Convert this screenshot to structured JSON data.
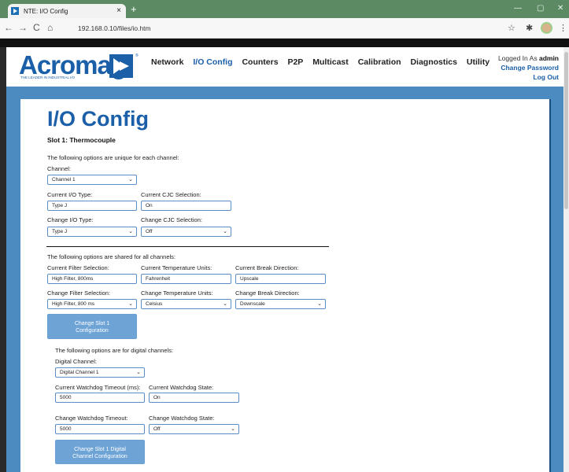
{
  "browser": {
    "tab_title": "NTE: I/O Config",
    "tab_close": "×",
    "new_tab": "+",
    "url": "192.168.0.10/files/io.htm",
    "back": "←",
    "forward": "→",
    "reload": "C",
    "home": "⌂",
    "minimize": "—",
    "maximize": "▢",
    "close": "✕",
    "star": "☆",
    "puzzle": "✱",
    "menu": "⋮"
  },
  "header": {
    "logo_text": "Acromag",
    "logo_reg": "®",
    "logo_tagline": "THE LEADER IN INDUSTRIAL I/O",
    "menu": [
      {
        "label": "Network"
      },
      {
        "label": "I/O Config"
      },
      {
        "label": "Counters"
      },
      {
        "label": "P2P"
      },
      {
        "label": "Multicast"
      },
      {
        "label": "Calibration"
      },
      {
        "label": "Diagnostics"
      },
      {
        "label": "Utility"
      }
    ],
    "logged_in_prefix": "Logged In As",
    "logged_in_user": "admin",
    "change_password": "Change Password",
    "log_out": "Log Out"
  },
  "page": {
    "title": "I/O Config",
    "subtitle": "Slot 1: Thermocouple",
    "unique_intro": "The following options are unique for each channel:",
    "channel_label": "Channel:",
    "channel_value": "Channel 1",
    "current_io_type_label": "Current I/O Type:",
    "current_io_type_value": "Type J",
    "current_cjc_label": "Current CJC Selection:",
    "current_cjc_value": "On",
    "change_io_type_label": "Change I/O Type:",
    "change_io_type_value": "Type J",
    "change_cjc_label": "Change CJC Selection:",
    "change_cjc_value": "Off",
    "shared_intro": "The following options are shared for all channels:",
    "current_filter_label": "Current Filter Selection:",
    "current_filter_value": "High Filter, 800ms",
    "current_temp_label": "Current Temperature Units:",
    "current_temp_value": "Fahrenheit",
    "current_break_label": "Current Break Direction:",
    "current_break_value": "Upscale",
    "change_filter_label": "Change Filter Selection:",
    "change_filter_value": "High Filter, 800 ms",
    "change_temp_label": "Change Temperature Units:",
    "change_temp_value": "Celsius",
    "change_break_label": "Change Break Direction:",
    "change_break_value": "Downscale",
    "change_slot_button_line1": "Change Slot 1",
    "change_slot_button_line2": "Configuration",
    "digital_intro": "The following options are for digital channels:",
    "digital_channel_label": "Digital Channel:",
    "digital_channel_value": "Digital Channel 1",
    "current_watchdog_timeout_label": "Current Watchdog Timeout (ms):",
    "current_watchdog_timeout_value": "5000",
    "current_watchdog_state_label": "Current Watchdog State:",
    "current_watchdog_state_value": "On",
    "change_watchdog_timeout_label": "Change Watchdog Timeout:",
    "change_watchdog_timeout_value": "5000",
    "change_watchdog_state_label": "Change Watchdog State:",
    "change_watchdog_state_value": "Off",
    "change_digital_button_line1": "Change Slot 1 Digital",
    "change_digital_button_line2": "Channel Configuration"
  },
  "colors": {
    "brand_blue": "#1a5fa8",
    "page_bg": "#4b8bbf",
    "button_bg": "#6ea3d6",
    "tabbar_green": "#5b8a63"
  }
}
